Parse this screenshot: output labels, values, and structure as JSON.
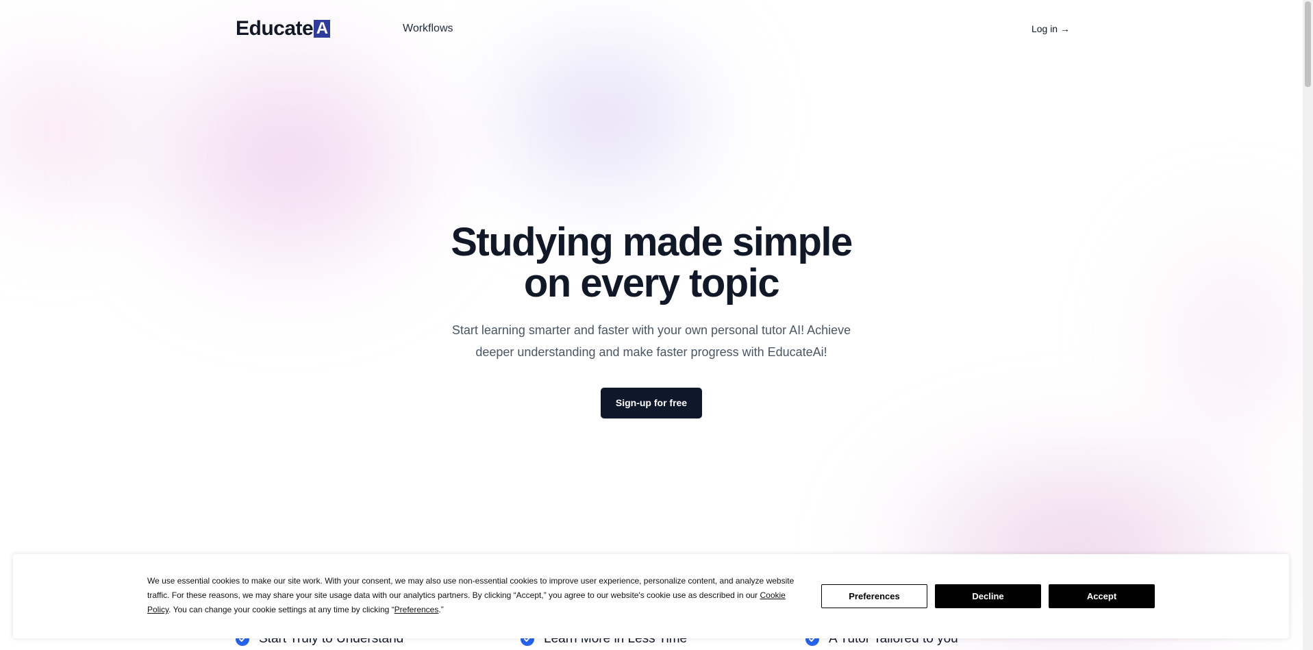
{
  "nav": {
    "logo_text": "Educate",
    "logo_mark": "A",
    "workflows_label": "Workflows",
    "login_label": "Log in →"
  },
  "hero": {
    "title_line1": "Studying made simple",
    "title_line2": "on every topic",
    "subtitle": "Start learning smarter and faster with your own personal tutor AI! Achieve deeper understanding and make faster progress with EducateAi!",
    "cta_label": "Sign-up for free"
  },
  "features": [
    {
      "label": "Start Truly to Understand",
      "icon": "check-circle-icon"
    },
    {
      "label": "Learn More in Less Time",
      "icon": "check-circle-icon"
    },
    {
      "label": "A Tutor Tailored to you",
      "icon": "check-circle-icon"
    }
  ],
  "cookie_banner": {
    "text_part1": "We use essential cookies to make our site work. With your consent, we may also use non-essential cookies to improve user experience, personalize content, and analyze website traffic. For these reasons, we may share your site usage data with our analytics partners. By clicking “Accept,” you agree to our website's cookie use as described in our ",
    "cookie_policy_link": "Cookie Policy",
    "text_part2": ". You can change your cookie settings at any time by clicking “",
    "preferences_link": "Preferences",
    "text_part3": ".”",
    "preferences_button": "Preferences",
    "decline_button": "Decline",
    "accept_button": "Accept"
  },
  "colors": {
    "brand_dark": "#0f172a",
    "logo_mark_bg": "#2f3c9c",
    "check_blue": "#2563eb"
  }
}
